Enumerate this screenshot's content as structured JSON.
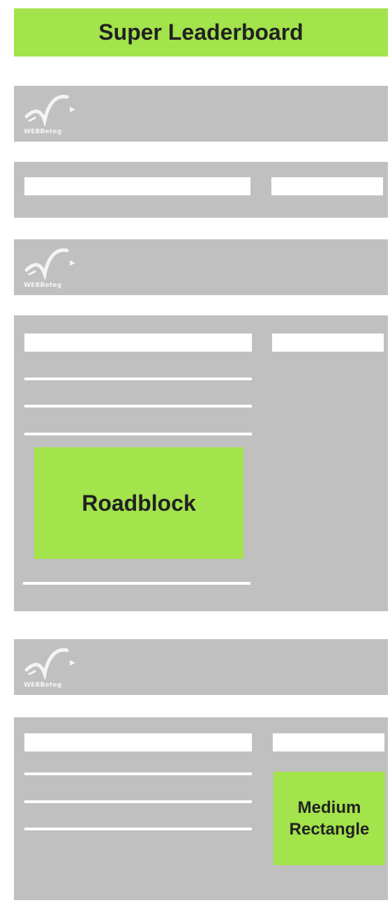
{
  "banners": {
    "super_leaderboard": "Super Leaderboard",
    "roadblock": "Roadblock",
    "medium_rectangle_line1": "Medium",
    "medium_rectangle_line2": "Rectangle"
  },
  "logo": {
    "text": "WEBBeteg",
    "icon": "webbeteg-swoosh-logo"
  },
  "colors": {
    "banner_green": "#a3e34b",
    "panel_grey": "#c0c0c0",
    "placeholder_white": "#ffffff",
    "text_dark": "#222222"
  }
}
